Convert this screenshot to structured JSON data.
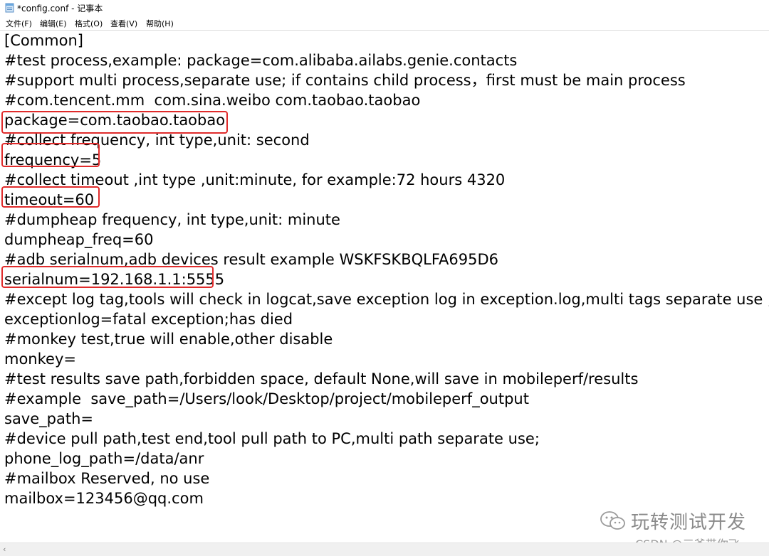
{
  "window": {
    "title": "*config.conf - 记事本",
    "app_icon": "notepad-icon"
  },
  "menu": [
    {
      "label": "文件(F)"
    },
    {
      "label": "编辑(E)"
    },
    {
      "label": "格式(O)"
    },
    {
      "label": "查看(V)"
    },
    {
      "label": "帮助(H)"
    }
  ],
  "editor": {
    "lines": [
      "[Common]",
      "#test process,example: package=com.alibaba.ailabs.genie.contacts",
      "#support multi process,separate use; if contains child process，first must be main process",
      "#com.tencent.mm  com.sina.weibo com.taobao.taobao",
      "package=com.taobao.taobao",
      "#collect frequency, int type,unit: second",
      "frequency=5",
      "#collect timeout ,int type ,unit:minute, for example:72 hours 4320",
      "timeout=60",
      "#dumpheap frequency, int type,unit: minute",
      "dumpheap_freq=60",
      "#adb serialnum,adb devices result example WSKFSKBQLFA695D6",
      "serialnum=192.168.1.1:5555",
      "#except log tag,tools will check in logcat,save exception log in exception.log,multi tags separate use ;",
      "exceptionlog=fatal exception;has died",
      "#monkey test,true will enable,other disable",
      "monkey=",
      "#test results save path,forbidden space, default None,will save in mobileperf/results",
      "#example  save_path=/Users/look/Desktop/project/mobileperf_output",
      "save_path=",
      "#device pull path,test end,tool pull path to PC,multi path separate use;",
      "phone_log_path=/data/anr",
      "#mailbox Reserved, no use",
      "mailbox=123456@qq.com"
    ],
    "highlighted_lines": [
      "package=com.taobao.taobao",
      "frequency=5",
      "timeout=60",
      "serialnum=192.168.1.1:5555"
    ],
    "highlight_color": "#e02b2b"
  },
  "watermark": {
    "text": "玩转测试开发",
    "icon": "wechat-icon"
  },
  "csdn_mark": "CSDN @三爷带你飞",
  "scrollbar": {
    "left_arrow": "‹"
  }
}
